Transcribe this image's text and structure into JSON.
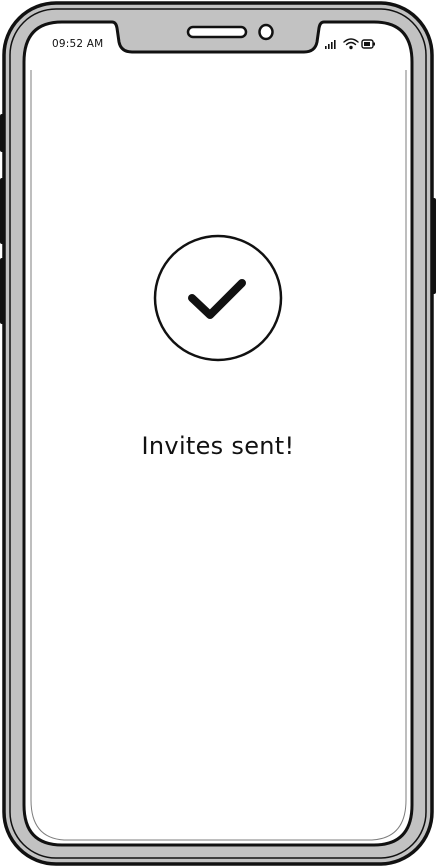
{
  "status_bar": {
    "time": "09:52 AM",
    "icons": [
      "cellular-signal-icon",
      "wifi-icon",
      "battery-icon"
    ]
  },
  "main": {
    "status_icon": "checkmark-circle-icon",
    "message": "Invites sent!"
  },
  "colors": {
    "frame": "#c2c2c2",
    "stroke": "#111111",
    "screen": "#ffffff"
  }
}
